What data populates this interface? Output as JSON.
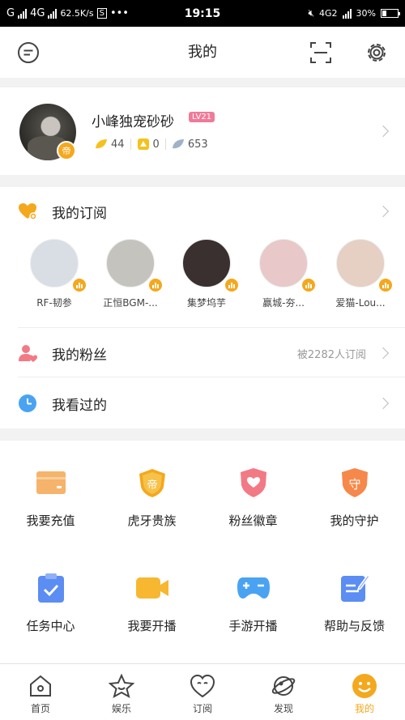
{
  "status_bar": {
    "carrier_left": "G",
    "network": "4G",
    "speed": "62.5K/s",
    "s_badge": "S",
    "dots": "•••",
    "time": "19:15",
    "network_right": "4G2",
    "battery_text": "30%"
  },
  "header": {
    "title": "我的"
  },
  "profile": {
    "username": "小峰独宠砂砂",
    "level": "LV21",
    "badge": "帝",
    "stats": {
      "leaf": "44",
      "coin": "0",
      "feather": "653"
    }
  },
  "subscribe": {
    "label": "我的订阅",
    "anchors": [
      {
        "name": "RF-韧参",
        "color": "#d9dde4"
      },
      {
        "name": "正恒BGM-...",
        "color": "#c5c3bd"
      },
      {
        "name": "集梦坞芋",
        "color": "#3a3030"
      },
      {
        "name": "赢城-夯...",
        "color": "#e8c8c8"
      },
      {
        "name": "爱猫-Lou...",
        "color": "#e6cfc3"
      }
    ]
  },
  "fans": {
    "label": "我的粉丝",
    "extra": "被2282人订阅"
  },
  "history": {
    "label": "我看过的"
  },
  "grid": [
    {
      "label": "我要充值",
      "icon": "wallet-icon",
      "color": "#f6b36b"
    },
    {
      "label": "虎牙贵族",
      "icon": "noble-shield-icon",
      "color": "#f4a81d"
    },
    {
      "label": "粉丝徽章",
      "icon": "fan-badge-icon",
      "color": "#f27a85"
    },
    {
      "label": "我的守护",
      "icon": "guard-shield-icon",
      "color": "#f5884a"
    },
    {
      "label": "任务中心",
      "icon": "task-clipboard-icon",
      "color": "#5b8df2"
    },
    {
      "label": "我要开播",
      "icon": "video-camera-icon",
      "color": "#f7b731"
    },
    {
      "label": "手游开播",
      "icon": "gamepad-icon",
      "color": "#4aa3f2"
    },
    {
      "label": "帮助与反馈",
      "icon": "feedback-edit-icon",
      "color": "#5b8df2"
    }
  ],
  "tabs": [
    {
      "label": "首页",
      "icon": "home-icon"
    },
    {
      "label": "娱乐",
      "icon": "star-icon"
    },
    {
      "label": "订阅",
      "icon": "heart-icon"
    },
    {
      "label": "发现",
      "icon": "planet-icon"
    },
    {
      "label": "我的",
      "icon": "smile-icon",
      "active": true
    }
  ],
  "colors": {
    "accent": "#f4a81d",
    "fan_icon": "#f27a85",
    "history_icon": "#4aa3f2"
  }
}
